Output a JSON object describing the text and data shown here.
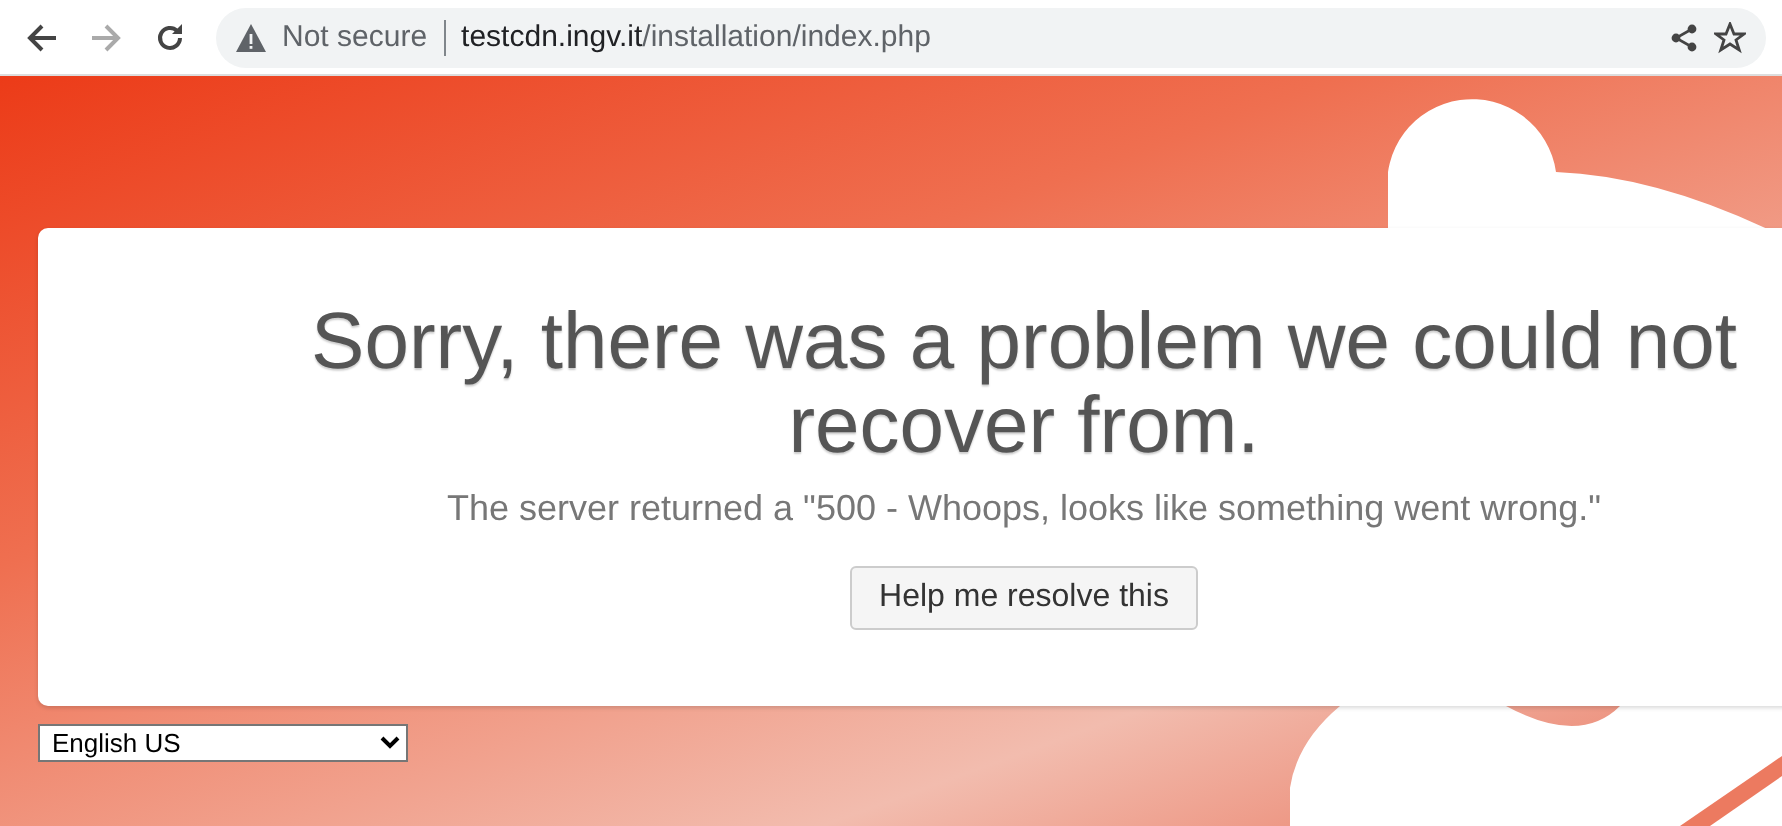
{
  "browser": {
    "security": "Not secure",
    "url_host": "testcdn.ingv.it",
    "url_path": "/installation/index.php"
  },
  "error": {
    "title": "Sorry, there was a problem we could not recover from.",
    "message": "The server returned a \"500 - Whoops, looks like something went wrong.\"",
    "button": "Help me resolve this"
  },
  "language": {
    "value": "English US"
  }
}
